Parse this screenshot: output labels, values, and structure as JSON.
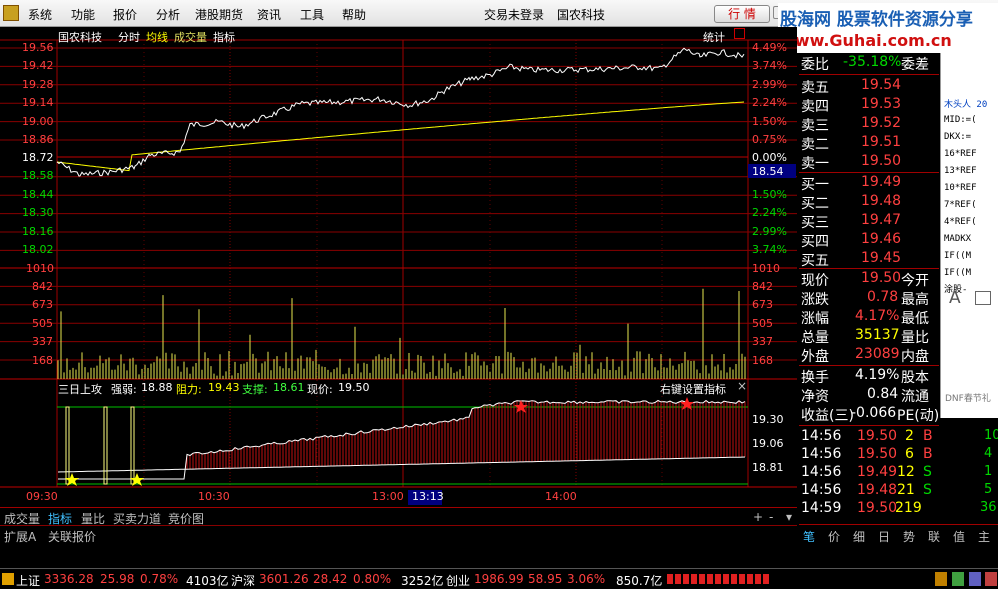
{
  "app": {
    "logo": "app-logo",
    "title_center": "交易未登录",
    "stock_name": "国农科技",
    "market_btn": "行 情"
  },
  "menu": [
    "系统",
    "功能",
    "报价",
    "分析",
    "港股期货",
    "资讯",
    "工具",
    "帮助"
  ],
  "watermark": {
    "line1": "股海网 股票软件资源分享",
    "line2": "www.Guhai.com.cn"
  },
  "sidewin": [
    "木头人 20",
    "MID:=(",
    "DKX:=",
    "16*REF",
    "13*REF",
    "10*REF",
    "7*REF(",
    "4*REF(",
    "MADKX",
    "IF((M",
    "IF((M",
    "涂股-"
  ],
  "chart_header": {
    "name": "国农科技",
    "tabs": [
      "分时",
      "均线",
      "成交量",
      "指标"
    ],
    "right": "统计"
  },
  "price_axis": {
    "left": [
      "19.56",
      "19.42",
      "19.28",
      "19.14",
      "19.00",
      "18.86",
      "18.72",
      "18.58",
      "18.44",
      "18.30",
      "18.16",
      "18.02"
    ],
    "right": [
      "4.49%",
      "3.74%",
      "2.99%",
      "2.24%",
      "1.50%",
      "0.75%",
      "0.00%",
      "0.75%",
      "1.50%",
      "2.24%",
      "2.99%",
      "3.74%"
    ],
    "cursor": "18.54"
  },
  "volume_axis": [
    "1010",
    "842",
    "673",
    "505",
    "337",
    "168"
  ],
  "indicator": {
    "name": "三日上攻",
    "strong_label": "强弱:",
    "strong": "18.88",
    "resist_label": "阻力:",
    "resist": "19.43",
    "support_label": "支撑:",
    "support": "18.61",
    "price_label": "现价:",
    "price": "19.50",
    "settings": "右键设置指标",
    "axis": [
      "19.30",
      "19.06",
      "18.81"
    ]
  },
  "time_axis": [
    "09:30",
    "10:30",
    "13:00",
    "13:13",
    "14:00"
  ],
  "bottom_tabs": [
    "成交量",
    "指标",
    "量比",
    "买卖力道",
    "竞价图"
  ],
  "ext_tabs": [
    "扩展A",
    "关联报价"
  ],
  "quote": {
    "weibi": {
      "label": "委比",
      "value": "-35.18%",
      "label2": "委差"
    },
    "sell": [
      {
        "label": "卖五",
        "price": "19.54"
      },
      {
        "label": "卖四",
        "price": "19.53"
      },
      {
        "label": "卖三",
        "price": "19.52"
      },
      {
        "label": "卖二",
        "price": "19.51"
      },
      {
        "label": "卖一",
        "price": "19.50"
      }
    ],
    "buy": [
      {
        "label": "买一",
        "price": "19.49"
      },
      {
        "label": "买二",
        "price": "19.48"
      },
      {
        "label": "买三",
        "price": "19.47"
      },
      {
        "label": "买四",
        "price": "19.46"
      },
      {
        "label": "买五",
        "price": "19.45"
      }
    ],
    "stats": [
      {
        "l": "现价",
        "v": "19.50",
        "r": "今开"
      },
      {
        "l": "涨跌",
        "v": "0.78",
        "r": "最高"
      },
      {
        "l": "涨幅",
        "v": "4.17%",
        "r": "最低"
      },
      {
        "l": "总量",
        "v": "35137",
        "r": "量比"
      },
      {
        "l": "外盘",
        "v": "23089",
        "r": "内盘"
      }
    ],
    "stats2": [
      {
        "l": "换手",
        "v": "4.19%",
        "r": "股本"
      },
      {
        "l": "净资",
        "v": "0.84",
        "r": "流通"
      },
      {
        "l": "收益(三)",
        "v": "-0.066",
        "r": "PE(动)"
      }
    ],
    "ticks": [
      {
        "t": "14:56",
        "p": "19.50",
        "v": "2",
        "d": "B"
      },
      {
        "t": "14:56",
        "p": "19.50",
        "v": "6",
        "d": "B"
      },
      {
        "t": "14:56",
        "p": "19.49",
        "v": "12",
        "d": "S"
      },
      {
        "t": "14:56",
        "p": "19.48",
        "v": "21",
        "d": "S"
      },
      {
        "t": "14:59",
        "p": "19.50",
        "v": "219",
        "d": ""
      }
    ],
    "tick_extra": [
      "10",
      "4",
      "1",
      "5",
      "36"
    ]
  },
  "rp_tabs": [
    "笔",
    "价",
    "细",
    "日",
    "势",
    "联",
    "值",
    "主"
  ],
  "status": {
    "sh_label": "上证",
    "sh": "3336.28",
    "sh_chg": "25.98",
    "sh_pct": "0.78%",
    "sh_amt": "4103亿",
    "sz_label": "沪深",
    "sz": "3601.26",
    "sz_chg": "28.42",
    "sz_pct": "0.80%",
    "sz_amt": "3252亿",
    "cy_label": "创业",
    "cy": "1986.99",
    "cy_chg": "58.95",
    "cy_pct": "3.06%",
    "cy_amt": "850.7亿"
  },
  "side_letter": "A",
  "side_ad": "DNF春节礼"
}
